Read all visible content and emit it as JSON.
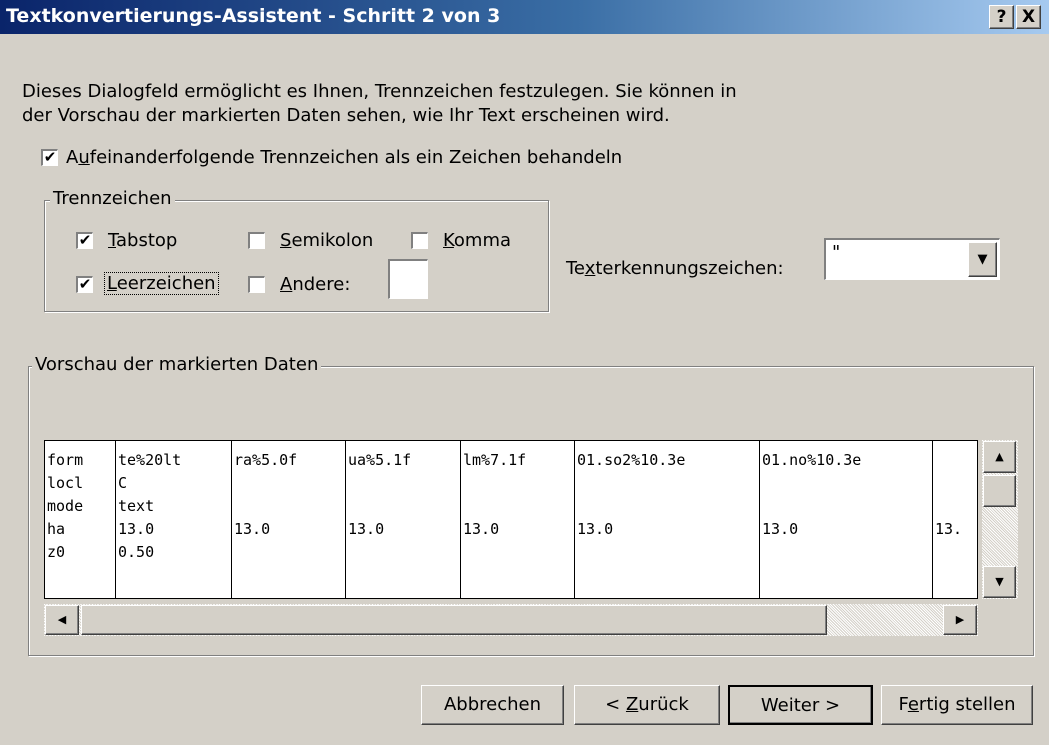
{
  "window": {
    "title": "Textkonvertierungs-Assistent - Schritt 2 von 3",
    "help_button": "?",
    "close_button": "X"
  },
  "description": {
    "line1": "Dieses Dialogfeld ermöglicht es Ihnen, Trennzeichen festzulegen. Sie können in",
    "line2": "der Vorschau der markierten Daten sehen, wie Ihr Text erscheinen wird."
  },
  "consecutive": {
    "checked": true,
    "label_pre": "A",
    "label_key": "u",
    "label_post": "feinanderfolgende Trennzeichen als ein Zeichen behandeln"
  },
  "delimiters": {
    "group_label": "Trennzeichen",
    "tab": {
      "checked": true,
      "key": "T",
      "rest": "abstop"
    },
    "semicolon": {
      "checked": false,
      "key": "S",
      "rest": "emikolon"
    },
    "comma": {
      "checked": false,
      "key": "K",
      "rest": "omma"
    },
    "space": {
      "checked": true,
      "key": "L",
      "rest": "eerzeichen"
    },
    "other": {
      "checked": false,
      "key": "A",
      "rest": "ndere:",
      "value": ""
    }
  },
  "text_qualifier": {
    "label_pre": "Te",
    "label_key": "x",
    "label_post": "terkennungszeichen:",
    "value": "\""
  },
  "preview": {
    "group_label": "Vorschau der markierten Daten",
    "columns": [
      [
        "form",
        "locl",
        "mode",
        "ha",
        "z0"
      ],
      [
        "te%20lt",
        "C",
        "text",
        "13.0",
        "0.50"
      ],
      [
        "ra%5.0f",
        "",
        "",
        "13.0",
        ""
      ],
      [
        "ua%5.1f",
        "",
        "",
        "13.0",
        ""
      ],
      [
        "lm%7.1f",
        "",
        "",
        "13.0",
        ""
      ],
      [
        "01.so2%10.3e",
        "",
        "",
        "13.0",
        ""
      ],
      [
        "01.no%10.3e",
        "",
        "",
        "13.0",
        ""
      ],
      [
        "",
        "",
        "",
        "13.",
        ""
      ]
    ]
  },
  "buttons": {
    "cancel": "Abbrechen",
    "back_pre": "< ",
    "back_key": "Z",
    "back_post": "urück",
    "next": "Weiter >",
    "finish_pre": "F",
    "finish_key": "e",
    "finish_post": "rtig stellen"
  }
}
